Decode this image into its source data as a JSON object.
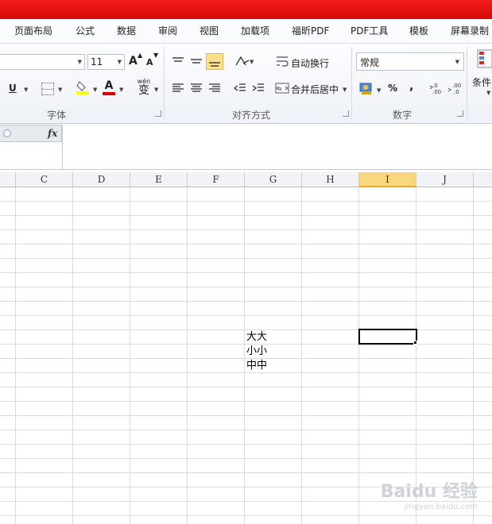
{
  "menu_tabs": [
    "页面布局",
    "公式",
    "数据",
    "审阅",
    "视图",
    "加载项",
    "福昕PDF",
    "PDF工具",
    "模板",
    "屏幕录制"
  ],
  "ribbon": {
    "font_size": "11",
    "groups": {
      "font": "字体",
      "alignment": "对齐方式",
      "number": "数字"
    },
    "wrap_text_label": "自动换行",
    "merge_center_label": "合并后居中",
    "number_format": "常规",
    "percent": "%",
    "comma": ",",
    "conditional_label": "条件",
    "underline": "U",
    "font_color_glyph": "A",
    "phonetic_glyph": "wén",
    "phonetic_char": "变",
    "inc_font": "A",
    "dec_font": "A"
  },
  "formula_bar": {
    "fx": "fx",
    "value": ""
  },
  "columns": [
    "C",
    "D",
    "E",
    "F",
    "G",
    "H",
    "I",
    "J"
  ],
  "selected_column": "I",
  "cells": {
    "g_lines": [
      "大大",
      "小小",
      "中中"
    ]
  },
  "watermark": {
    "main": "Baidu 经验",
    "sub": "jingyan.baidu.com"
  }
}
